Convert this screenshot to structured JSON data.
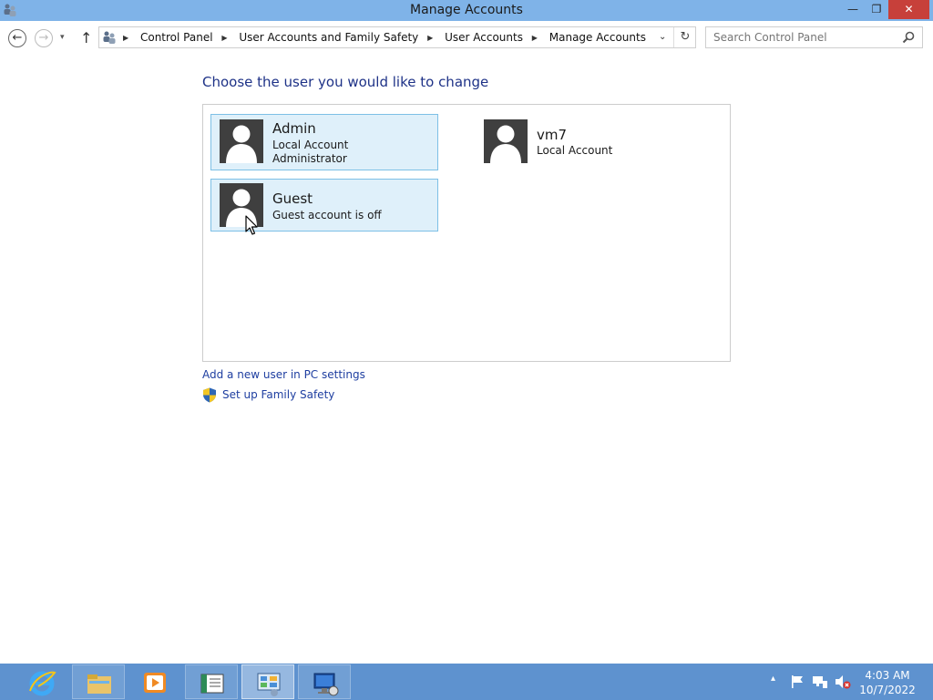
{
  "window": {
    "title": "Manage Accounts",
    "minimize_glyph": "—",
    "maximize_glyph": "❐",
    "close_glyph": "✕"
  },
  "nav": {
    "back_glyph": "←",
    "forward_glyph": "→",
    "history_glyph": "▾",
    "up_glyph": "↑",
    "breadcrumbs": [
      "Control Panel",
      "User Accounts and Family Safety",
      "User Accounts",
      "Manage Accounts"
    ],
    "address_dropdown_glyph": "⌄",
    "refresh_glyph": "↻"
  },
  "search": {
    "placeholder": "Search Control Panel"
  },
  "main": {
    "heading": "Choose the user you would like to change",
    "accounts": [
      {
        "name": "Admin",
        "lines": [
          "Local Account",
          "Administrator"
        ],
        "selected": true
      },
      {
        "name": "vm7",
        "lines": [
          "Local Account"
        ],
        "selected": false
      },
      {
        "name": "Guest",
        "lines": [
          "Guest account is off"
        ],
        "selected": true
      }
    ],
    "links": {
      "add_user": "Add a new user in PC settings",
      "family_safety": "Set up Family Safety"
    }
  },
  "taskbar": {
    "apps": [
      "internet-explorer",
      "file-explorer",
      "media-player",
      "document",
      "control-panel",
      "remote-desktop"
    ],
    "active_app": "control-panel",
    "clock_time": "4:03 AM",
    "clock_date": "10/7/2022",
    "tray_arrow_glyph": "▴"
  },
  "colors": {
    "titlebar": "#7fb3e8",
    "taskbar": "#5e92cf",
    "heading": "#1e3287",
    "link": "#1e3ea0",
    "tile_selected_bg": "#dff0fa",
    "tile_selected_border": "#7dc0e6",
    "close_button": "#c7403a"
  }
}
